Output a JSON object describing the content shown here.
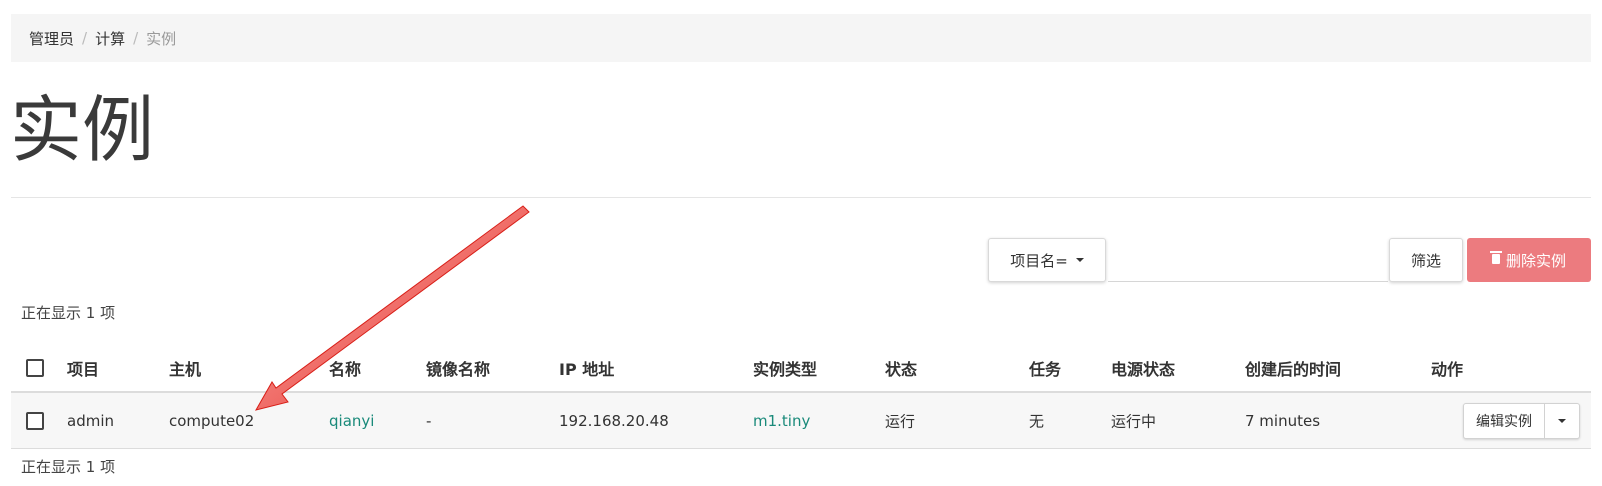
{
  "breadcrumb": {
    "items": [
      "管理员",
      "计算"
    ],
    "current": "实例",
    "separator": "/"
  },
  "page": {
    "title": "实例"
  },
  "toolbar": {
    "filter_field": "项目名=",
    "filter_value": "",
    "filter_button": "筛选",
    "delete_button": "删除实例"
  },
  "table": {
    "count_top": "正在显示 1 项",
    "count_bottom": "正在显示 1 项",
    "columns": {
      "project": "项目",
      "host": "主机",
      "name": "名称",
      "image": "镜像名称",
      "ip": "IP 地址",
      "flavor": "实例类型",
      "status": "状态",
      "task": "任务",
      "power": "电源状态",
      "age": "创建后的时间",
      "actions": "动作"
    },
    "rows": [
      {
        "project": "admin",
        "host": "compute02",
        "name": "qianyi",
        "image": "-",
        "ip": "192.168.20.48",
        "flavor": "m1.tiny",
        "status": "运行",
        "task": "无",
        "power": "运行中",
        "age": "7 minutes",
        "action_label": "编辑实例"
      }
    ]
  },
  "colors": {
    "accent": "#1a8a7a",
    "danger": "#ec7b7f",
    "annotation": "#e8261f"
  }
}
